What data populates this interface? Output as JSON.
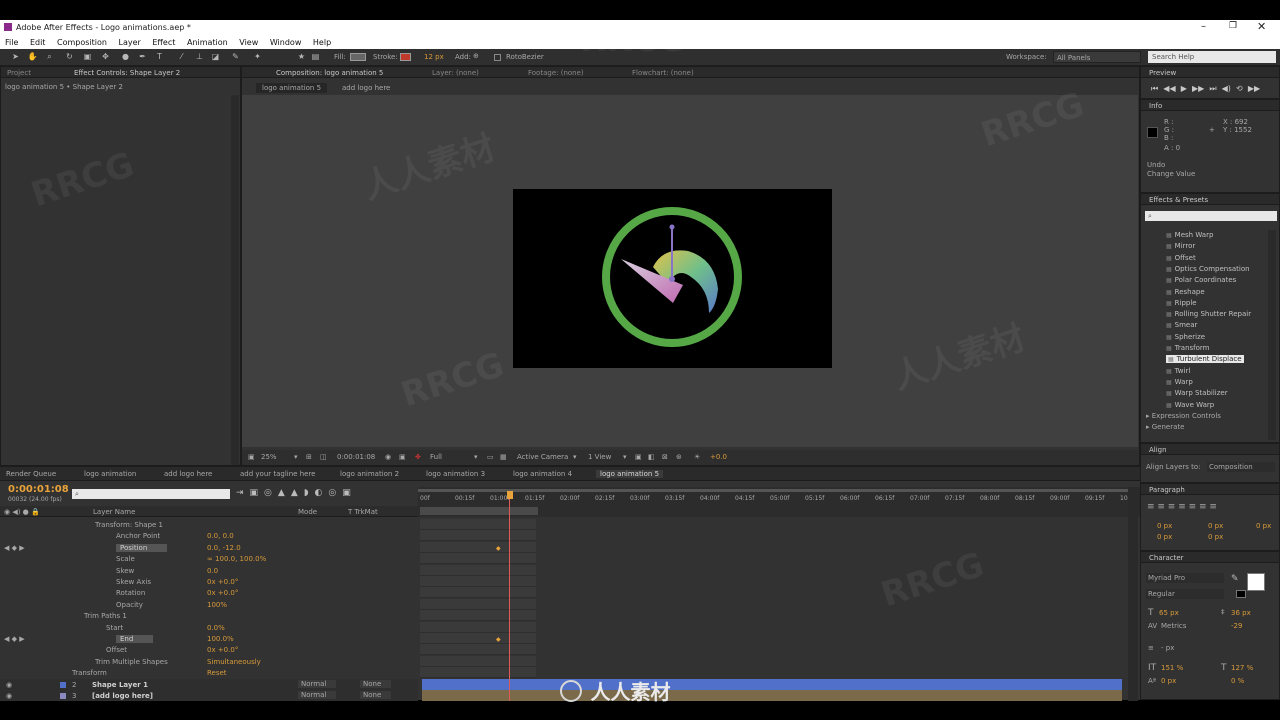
{
  "app": {
    "title": "Adobe After Effects - Logo animations.aep *",
    "menu": [
      "File",
      "Edit",
      "Composition",
      "Layer",
      "Effect",
      "Animation",
      "View",
      "Window",
      "Help"
    ]
  },
  "toolbar": {
    "fill_label": "Fill:",
    "stroke_label": "Stroke:",
    "stroke_width": "12 px",
    "add_label": "Add:",
    "rotobezier": "RotoBezier",
    "workspace_label": "Workspace:",
    "workspace_value": "All Panels",
    "search_help": "Search Help"
  },
  "left_panel": {
    "tab_project": "Project",
    "tab_effect_controls": "Effect Controls: Shape Layer 2",
    "breadcrumb": "logo animation 5 • Shape Layer 2"
  },
  "composition": {
    "tab_comp": "Composition: logo animation 5",
    "tab_layer": "Layer: (none)",
    "tab_footage": "Footage: (none)",
    "tab_flowchart": "Flowchart: (none)",
    "subtab_1": "logo animation 5",
    "subtab_2": "add logo here",
    "zoom": "25%",
    "timecode": "0:00:01:08",
    "resolution": "Full",
    "camera": "Active Camera",
    "view": "1 View",
    "exposure": "+0.0"
  },
  "preview": {
    "title": "Preview"
  },
  "info": {
    "title": "Info",
    "r": "R :",
    "g": "G :",
    "b": "B :",
    "a": "A : 0",
    "x": "X : 692",
    "y": "Y : 1552",
    "undo": "Undo",
    "change": "Change Value"
  },
  "effects": {
    "title": "Effects & Presets",
    "items": [
      "Mesh Warp",
      "Mirror",
      "Offset",
      "Optics Compensation",
      "Polar Coordinates",
      "Reshape",
      "Ripple",
      "Rolling Shutter Repair",
      "Smear",
      "Spherize",
      "Transform",
      "Turbulent Displace",
      "Twirl",
      "Warp",
      "Warp Stabilizer",
      "Wave Warp"
    ],
    "selected": "Turbulent Displace",
    "group_1": "▸ Expression Controls",
    "group_2": "▸ Generate"
  },
  "align": {
    "title": "Align",
    "align_to_label": "Align Layers to:",
    "align_to_value": "Composition"
  },
  "paragraph": {
    "title": "Paragraph",
    "v1": "0 px",
    "v2": "0 px",
    "v3": "0 px",
    "v4": "0 px",
    "v5": "0 px"
  },
  "character": {
    "title": "Character",
    "font": "Myriad Pro",
    "style": "Regular",
    "size": "65 px",
    "leading": "36 px",
    "kerning": "Metrics",
    "tracking": "-29",
    "stroke": "- px",
    "vscale": "151 %",
    "hscale": "127 %",
    "baseline": "0 px",
    "tsume": "0 %"
  },
  "timeline": {
    "tabs": [
      "Render Queue",
      "logo animation",
      "add logo here",
      "add your tagline here",
      "logo animation 2",
      "logo animation 3",
      "logo animation 4",
      "logo animation 5"
    ],
    "active_tab": "logo animation 5",
    "timecode": "0:00:01:08",
    "frame_info": "00032 (24.00 fps)",
    "col_layer_name": "Layer Name",
    "col_mode": "Mode",
    "col_trkmat": "T  TrkMat",
    "ruler": [
      "00f",
      "00:15f",
      "01:00f",
      "01:15f",
      "02:00f",
      "02:15f",
      "03:00f",
      "03:15f",
      "04:00f",
      "04:15f",
      "05:00f",
      "05:15f",
      "06:00f",
      "06:15f",
      "07:00f",
      "07:15f",
      "08:00f",
      "08:15f",
      "09:00f",
      "09:15f",
      "10:0"
    ],
    "rows": [
      {
        "name": "Transform: Shape 1",
        "value": ""
      },
      {
        "name": "Anchor Point",
        "value": "0.0, 0.0"
      },
      {
        "name": "Position",
        "value": "0.0, -12.0"
      },
      {
        "name": "Scale",
        "value": "∞ 100.0, 100.0%"
      },
      {
        "name": "Skew",
        "value": "0.0"
      },
      {
        "name": "Skew Axis",
        "value": "0x +0.0°"
      },
      {
        "name": "Rotation",
        "value": "0x +0.0°"
      },
      {
        "name": "Opacity",
        "value": "100%"
      },
      {
        "name": "Trim Paths 1",
        "value": ""
      },
      {
        "name": "Start",
        "value": "0.0%"
      },
      {
        "name": "End",
        "value": "100.0%"
      },
      {
        "name": "Offset",
        "value": "0x +0.0°"
      },
      {
        "name": "Trim Multiple Shapes",
        "value": "Simultaneously"
      },
      {
        "name": "Transform",
        "value": "Reset"
      }
    ],
    "layers": [
      {
        "num": "2",
        "name": "Shape Layer 1",
        "mode": "Normal",
        "trkmat": "None"
      },
      {
        "num": "3",
        "name": "[add logo here]",
        "mode": "Normal",
        "trkmat": "None"
      }
    ]
  },
  "watermark": {
    "brand": "RRCG",
    "cn": "人人素材"
  },
  "colors": {
    "ring": "#56a847",
    "selection_blue": "#5170c9",
    "timecode_orange": "#e8a33a",
    "playhead": "#e05a5a"
  }
}
